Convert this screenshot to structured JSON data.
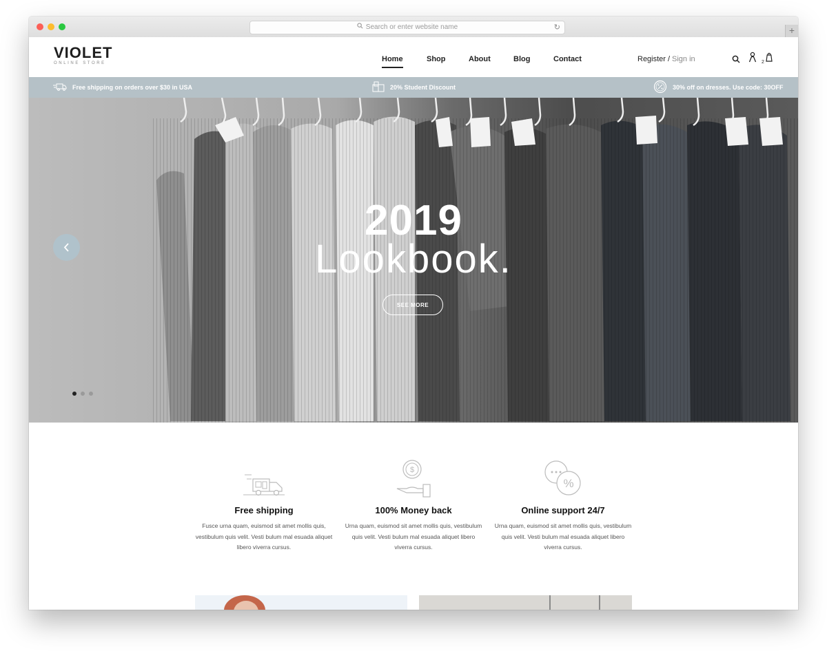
{
  "browser": {
    "address_placeholder": "Search or enter website name"
  },
  "header": {
    "logo": "VIOLET",
    "logo_sub": "ONLINE STORE",
    "nav": [
      "Home",
      "Shop",
      "About",
      "Blog",
      "Contact"
    ],
    "register": "Register",
    "separator": "/",
    "signin": "Sign in",
    "cart_count": "2",
    "icons": [
      "search-icon",
      "user-icon",
      "cart-bag-icon"
    ]
  },
  "promo": {
    "shipping": "Free shipping on orders over $30 in USA",
    "student": "20% Student Discount",
    "dresses": "30% off on dresses. Use code: 30OFF"
  },
  "hero": {
    "year": "2019",
    "title": "Lookbook.",
    "button": "SEE MORE",
    "active_slide": 1,
    "slides": 3
  },
  "features": [
    {
      "icon": "delivery-truck-icon",
      "title": "Free shipping",
      "text": "Fusce urna quam, euismod sit amet mollis quis, vestibulum quis velit. Vesti bulum mal esuada aliquet libero viverra cursus."
    },
    {
      "icon": "money-hand-icon",
      "title": "100% Money back",
      "text": "Urna quam, euismod sit amet mollis quis, vestibulum quis velit. Vesti bulum mal esuada aliquet libero viverra cursus."
    },
    {
      "icon": "support-chat-icon",
      "title": "Online support 24/7",
      "text": "Urna quam, euismod sit amet mollis quis, vestibulum quis velit. Vesti bulum mal esuada aliquet libero viverra cursus."
    }
  ],
  "colors": {
    "promo_bar": "#b5c1c7",
    "text_dark": "#222222",
    "muted": "#888888"
  }
}
